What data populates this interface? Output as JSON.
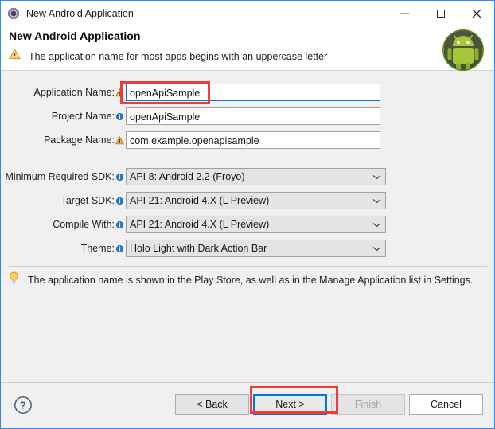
{
  "window": {
    "title": "New Android Application",
    "icon": "eclipse-wizard-icon",
    "controls": {
      "minimize": "minimize-icon",
      "maximize": "maximize-icon",
      "close": "close-icon"
    }
  },
  "header": {
    "title": "New Android Application",
    "message": "The application name for most apps begins with an uppercase letter",
    "message_icon": "warning-icon",
    "brand_icon": "android-robot-icon"
  },
  "form": {
    "text_fields": [
      {
        "label": "Application Name:",
        "badge": "warning-icon",
        "value": "openApiSample",
        "focused": true,
        "highlighted": true
      },
      {
        "label": "Project Name:",
        "badge": "info-icon",
        "value": "openApiSample",
        "focused": false,
        "highlighted": false
      },
      {
        "label": "Package Name:",
        "badge": "warning-icon",
        "value": "com.example.openapisample",
        "focused": false,
        "highlighted": false
      }
    ],
    "dropdowns": [
      {
        "label": "Minimum Required SDK:",
        "badge": "info-icon",
        "value": "API 8: Android 2.2 (Froyo)"
      },
      {
        "label": "Target SDK:",
        "badge": "info-icon",
        "value": "API 21: Android 4.X (L Preview)"
      },
      {
        "label": "Compile With:",
        "badge": "info-icon",
        "value": "API 21: Android 4.X (L Preview)"
      },
      {
        "label": "Theme:",
        "badge": "info-icon",
        "value": "Holo Light with Dark Action Bar"
      }
    ]
  },
  "hint": {
    "icon": "lightbulb-icon",
    "text": "The application name is shown in the Play Store, as well as in the Manage Application list in Settings."
  },
  "footer": {
    "help_icon": "help-icon",
    "buttons": [
      {
        "label": "< Back",
        "enabled": true,
        "focused": false
      },
      {
        "label": "Next >",
        "enabled": true,
        "focused": true
      },
      {
        "label": "Finish",
        "enabled": false,
        "focused": false
      },
      {
        "label": "Cancel",
        "enabled": true,
        "focused": false
      }
    ]
  },
  "colors": {
    "accent": "#0078d7",
    "annotation": "#ef3b3b",
    "warning": "#e8a33d",
    "info": "#2b74b8",
    "android_green": "#a4c639",
    "window_border": "#2f8fe8"
  }
}
